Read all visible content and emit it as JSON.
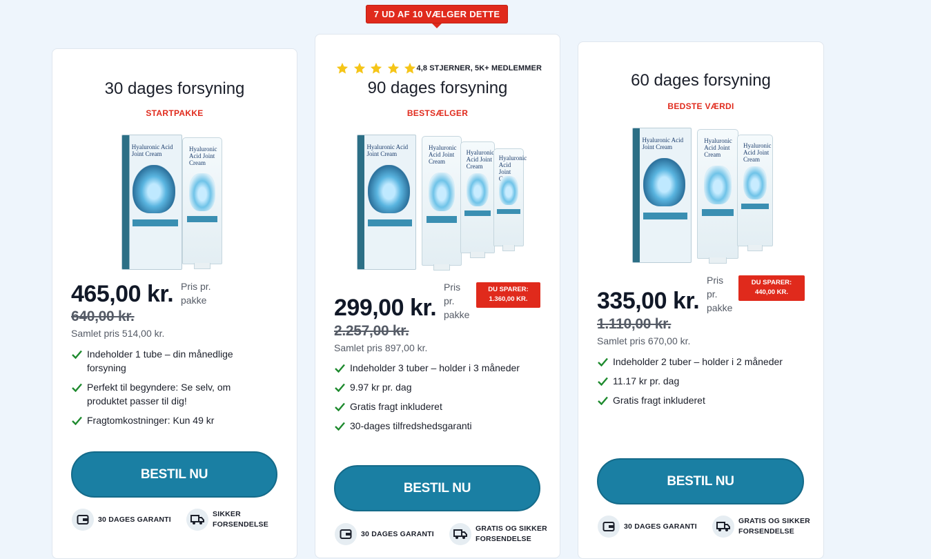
{
  "ribbon": "7 UD AF 10 VÆLGER DETTE",
  "colors": {
    "accent_red": "#e02a1c",
    "button_blue": "#1a7fa3",
    "check_green": "#1e8a2e",
    "star_yellow": "#f5c518"
  },
  "plans": [
    {
      "title": "30 dages forsyning",
      "subtitle": "STARTPAKKE",
      "image_label": "Hyaluronic Acid Joint Cream",
      "price": "465,00 kr.",
      "per_unit": "Pris pr. pakke",
      "old_price": "640,00 kr.",
      "total": "Samlet pris 514,00 kr.",
      "features": [
        "Indeholder 1 tube – din månedlige forsyning",
        "Perfekt til begyndere: Se selv, om produktet passer til dig!",
        "Fragtomkostninger: Kun 49 kr"
      ],
      "button": "BESTIL NU",
      "badges": [
        {
          "icon": "wallet-icon",
          "text": "30 DAGES GARANTI"
        },
        {
          "icon": "truck-icon",
          "text": "SIKKER FORSENDELSE"
        }
      ]
    },
    {
      "rating_stars": 5,
      "rating_text": "4,8 STJERNER, 5K+ MEDLEMMER",
      "title": "90 dages forsyning",
      "subtitle": "BESTSÆLGER",
      "image_label": "Hyaluronic Acid Joint Cream",
      "price": "299,00 kr.",
      "per_unit": "Pris pr. pakke",
      "save_label": "DU SPARER:",
      "save_amount": "1.360,00 KR.",
      "old_price": "2.257,00 kr.",
      "total": "Samlet pris 897,00 kr.",
      "features": [
        "Indeholder 3 tuber – holder i 3 måneder",
        "9.97 kr pr. dag",
        "Gratis fragt inkluderet",
        "30-dages tilfredshedsgaranti"
      ],
      "button": "BESTIL NU",
      "badges": [
        {
          "icon": "wallet-icon",
          "text": "30 DAGES GARANTI"
        },
        {
          "icon": "truck-icon",
          "text": "GRATIS OG SIKKER FORSENDELSE"
        }
      ]
    },
    {
      "title": "60 dages forsyning",
      "subtitle": "BEDSTE VÆRDI",
      "image_label": "Hyaluronic Acid Joint Cream",
      "price": "335,00 kr.",
      "per_unit": "Pris pr. pakke",
      "save_label": "DU SPARER:",
      "save_amount": "440,00 KR.",
      "old_price": "1.110,00 kr.",
      "total": "Samlet pris 670,00 kr.",
      "features": [
        "Indeholder 2 tuber – holder i 2 måneder",
        "11.17 kr pr. dag",
        "Gratis fragt inkluderet"
      ],
      "button": "BESTIL NU",
      "badges": [
        {
          "icon": "wallet-icon",
          "text": "30 DAGES GARANTI"
        },
        {
          "icon": "truck-icon",
          "text": "GRATIS OG SIKKER FORSENDELSE"
        }
      ]
    }
  ]
}
